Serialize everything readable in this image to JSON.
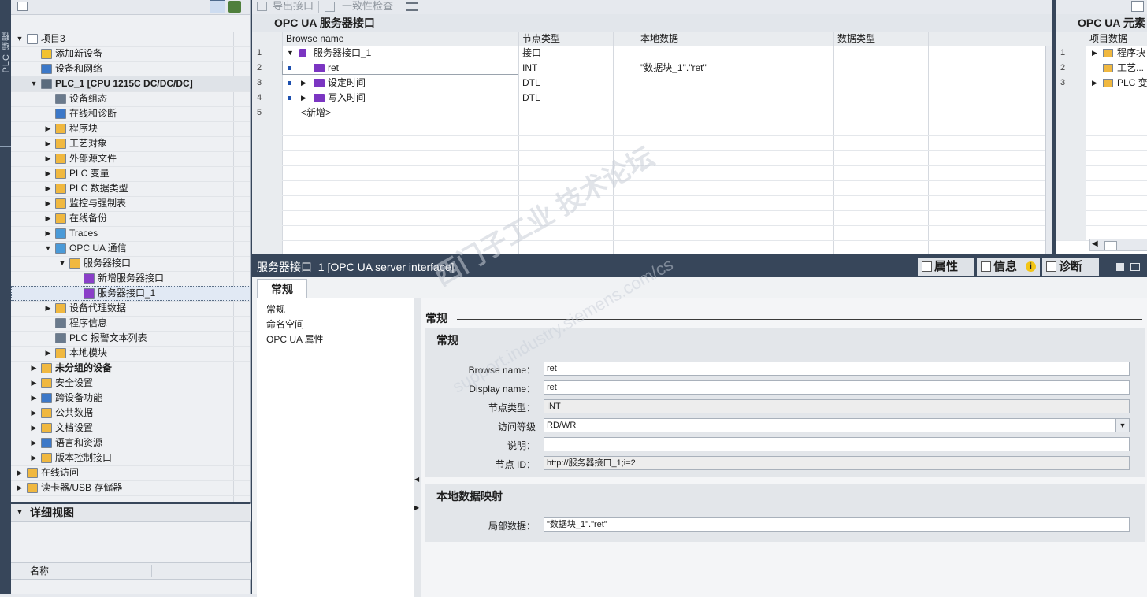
{
  "vertical_tab": "PLC 编程",
  "tree": {
    "items": [
      {
        "label": "项目3",
        "depth": 0,
        "arrow": "▼",
        "color": "#ffffff",
        "bold": false
      },
      {
        "label": "添加新设备",
        "depth": 1,
        "arrow": "",
        "color": "#f2c230",
        "bold": false
      },
      {
        "label": "设备和网络",
        "depth": 1,
        "arrow": "",
        "color": "#3c78c8",
        "bold": false
      },
      {
        "label": "PLC_1 [CPU 1215C DC/DC/DC]",
        "depth": 1,
        "arrow": "▼",
        "color": "#5a6b7d",
        "bold": true
      },
      {
        "label": "设备组态",
        "depth": 2,
        "arrow": "",
        "color": "#6a7a8c",
        "bold": false
      },
      {
        "label": "在线和诊断",
        "depth": 2,
        "arrow": "",
        "color": "#3c78c8",
        "bold": false
      },
      {
        "label": "程序块",
        "depth": 2,
        "arrow": "▶",
        "color": "#f0b840",
        "bold": false
      },
      {
        "label": "工艺对象",
        "depth": 2,
        "arrow": "▶",
        "color": "#f0b840",
        "bold": false
      },
      {
        "label": "外部源文件",
        "depth": 2,
        "arrow": "▶",
        "color": "#f0b840",
        "bold": false
      },
      {
        "label": "PLC 变量",
        "depth": 2,
        "arrow": "▶",
        "color": "#f0b840",
        "bold": false
      },
      {
        "label": "PLC 数据类型",
        "depth": 2,
        "arrow": "▶",
        "color": "#f0b840",
        "bold": false
      },
      {
        "label": "监控与强制表",
        "depth": 2,
        "arrow": "▶",
        "color": "#f0b840",
        "bold": false
      },
      {
        "label": "在线备份",
        "depth": 2,
        "arrow": "▶",
        "color": "#f0b840",
        "bold": false
      },
      {
        "label": "Traces",
        "depth": 2,
        "arrow": "▶",
        "color": "#4a9ad8",
        "bold": false
      },
      {
        "label": "OPC UA 通信",
        "depth": 2,
        "arrow": "▼",
        "color": "#4a9ad8",
        "bold": false
      },
      {
        "label": "服务器接口",
        "depth": 3,
        "arrow": "▼",
        "color": "#f0b840",
        "bold": false
      },
      {
        "label": "新增服务器接口",
        "depth": 4,
        "arrow": "",
        "color": "#8a3fc8",
        "bold": false
      },
      {
        "label": "服务器接口_1",
        "depth": 4,
        "arrow": "",
        "color": "#8a3fc8",
        "bold": false
      },
      {
        "label": "设备代理数据",
        "depth": 2,
        "arrow": "▶",
        "color": "#f0b840",
        "bold": false
      },
      {
        "label": "程序信息",
        "depth": 2,
        "arrow": "",
        "color": "#6a7a8c",
        "bold": false
      },
      {
        "label": "PLC 报警文本列表",
        "depth": 2,
        "arrow": "",
        "color": "#6a7a8c",
        "bold": false
      },
      {
        "label": "本地模块",
        "depth": 2,
        "arrow": "▶",
        "color": "#f0b840",
        "bold": false
      },
      {
        "label": "未分组的设备",
        "depth": 1,
        "arrow": "▶",
        "color": "#f0b840",
        "bold": true
      },
      {
        "label": "安全设置",
        "depth": 1,
        "arrow": "▶",
        "color": "#f0b840",
        "bold": false
      },
      {
        "label": "跨设备功能",
        "depth": 1,
        "arrow": "▶",
        "color": "#3c78c8",
        "bold": false
      },
      {
        "label": "公共数据",
        "depth": 1,
        "arrow": "▶",
        "color": "#f0b840",
        "bold": false
      },
      {
        "label": "文档设置",
        "depth": 1,
        "arrow": "▶",
        "color": "#f0b840",
        "bold": false
      },
      {
        "label": "语言和资源",
        "depth": 1,
        "arrow": "▶",
        "color": "#3c78c8",
        "bold": false
      },
      {
        "label": "版本控制接口",
        "depth": 1,
        "arrow": "▶",
        "color": "#f0b840",
        "bold": false
      },
      {
        "label": "在线访问",
        "depth": 0,
        "arrow": "▶",
        "color": "#f0b840",
        "bold": false
      },
      {
        "label": "读卡器/USB 存储器",
        "depth": 0,
        "arrow": "▶",
        "color": "#f0b840",
        "bold": false
      }
    ]
  },
  "detail_view": {
    "title": "详细视图",
    "col_name": "名称"
  },
  "editor": {
    "toolbar": {
      "export": "导出接口",
      "consistency": "一致性检查"
    },
    "title": "OPC UA 服务器接口",
    "headers": {
      "browse": "Browse name",
      "node_type": "节点类型",
      "local_data": "本地数据",
      "data_type": "数据类型"
    },
    "rows": [
      {
        "num": "1",
        "name": "服务器接口_1",
        "type": "接口",
        "local": "",
        "icon": "interface-icon"
      },
      {
        "num": "2",
        "name": "ret",
        "type": "INT",
        "local": "\"数据块_1\".\"ret\"",
        "icon": "variable-icon"
      },
      {
        "num": "3",
        "name": "设定时间",
        "type": "DTL",
        "local": "",
        "icon": "variable-icon"
      },
      {
        "num": "4",
        "name": "写入时间",
        "type": "DTL",
        "local": "",
        "icon": "variable-icon"
      },
      {
        "num": "5",
        "name": "<新增>",
        "type": "",
        "local": "",
        "icon": ""
      }
    ]
  },
  "right_panel": {
    "title": "OPC UA 元素",
    "header": "项目数据",
    "rows": [
      {
        "num": "1",
        "label": "程序块"
      },
      {
        "num": "2",
        "label": "工艺..."
      },
      {
        "num": "3",
        "label": "PLC 变..."
      }
    ]
  },
  "inspector": {
    "title": "服务器接口_1 [OPC UA server interface]",
    "tabs": {
      "properties": "属性",
      "info": "信息",
      "diagnostics": "诊断"
    },
    "subtab": "常规",
    "nav": [
      "常规",
      "命名空间",
      "OPC UA 属性"
    ],
    "content_heading": "常规",
    "general": {
      "heading": "常规",
      "browse_label": "Browse name：",
      "browse_value": "ret",
      "display_label": "Display name：",
      "display_value": "ret",
      "nodetype_label": "节点类型：",
      "nodetype_value": "INT",
      "access_label": "访问等级",
      "access_value": "RD/WR",
      "desc_label": "说明：",
      "desc_value": "",
      "nodeid_label": "节点 ID：",
      "nodeid_value": "http://服务器接口_1;i=2"
    },
    "mapping": {
      "heading": "本地数据映射",
      "local_label": "局部数据：",
      "local_value": "\"数据块_1\".\"ret\""
    }
  },
  "watermark": {
    "line1": "西门子工业  技术论坛",
    "line2": "support.industry.siemens.com/cs"
  }
}
